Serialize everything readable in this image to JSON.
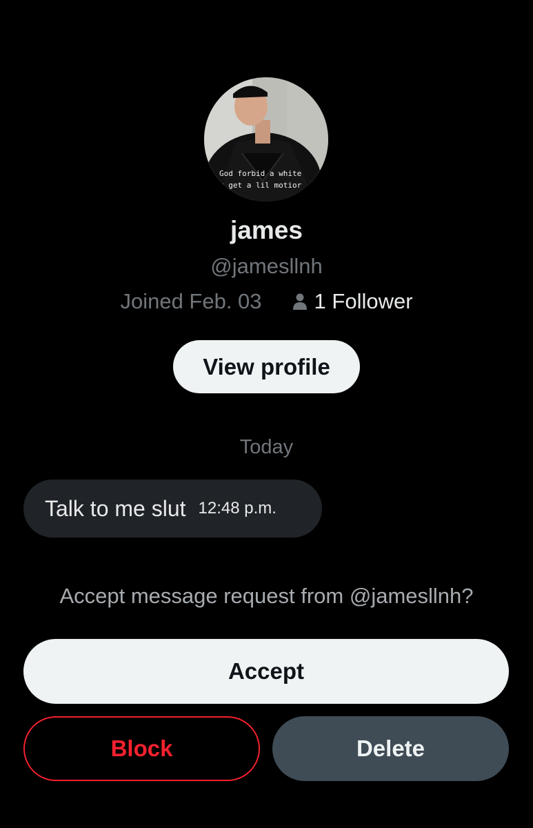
{
  "profile": {
    "display_name": "james",
    "handle": "@jamesllnh",
    "joined": "Joined Feb. 03",
    "followers": "1 Follower",
    "avatar_caption_line1": "God forbid a white",
    "avatar_caption_line2": "v get a lil motior",
    "view_profile_label": "View profile"
  },
  "conversation": {
    "date_divider": "Today",
    "messages": [
      {
        "text": "Talk to me slut",
        "time": "12:48 p.m."
      }
    ]
  },
  "request": {
    "prompt": "Accept message request from @jamesllnh?",
    "accept_label": "Accept",
    "block_label": "Block",
    "delete_label": "Delete"
  },
  "icons": {
    "followers_icon": "person-icon"
  },
  "colors": {
    "background": "#000000",
    "primary_text": "#e7e9ea",
    "secondary_text": "#71767b",
    "light_button": "#eff3f4",
    "block_red": "#f4212e",
    "delete_button": "#3f4c56",
    "bubble": "#202327"
  }
}
